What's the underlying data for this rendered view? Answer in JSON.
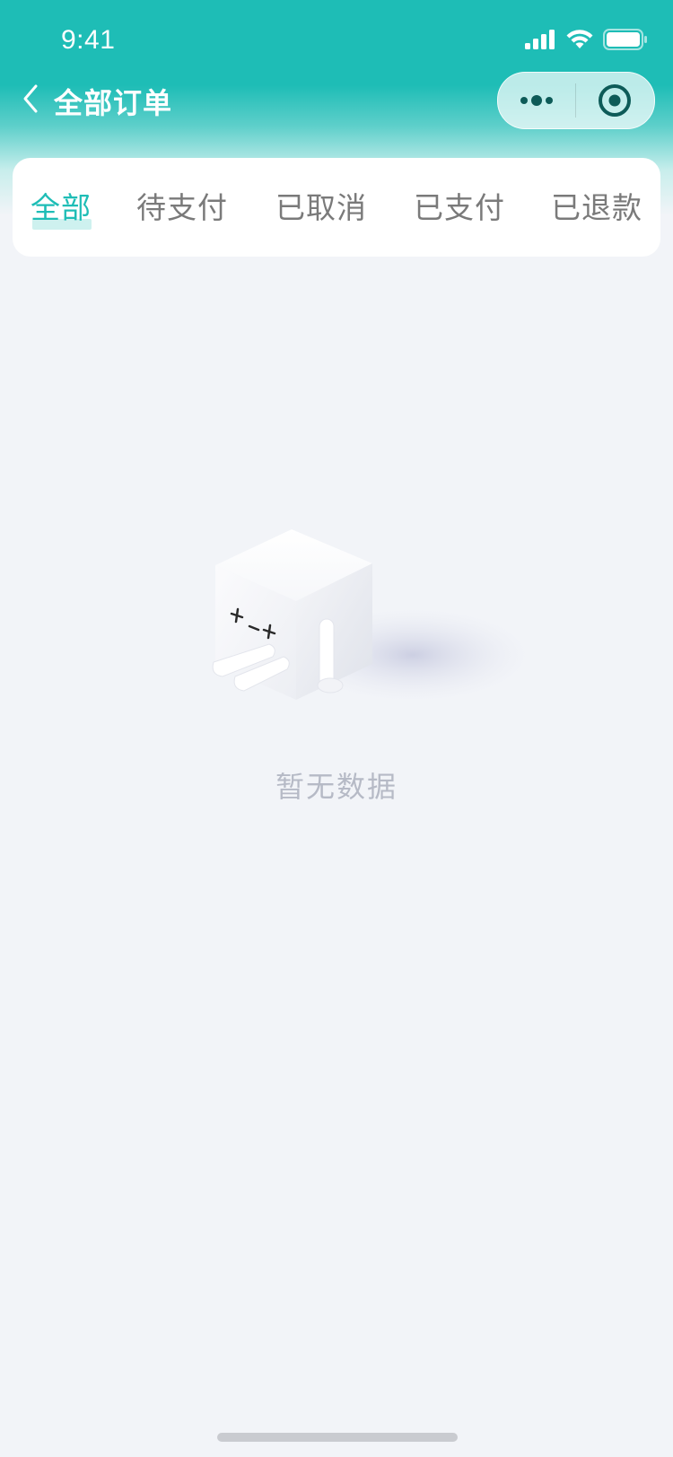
{
  "status_bar": {
    "time": "9:41"
  },
  "nav": {
    "title": "全部订单",
    "back_icon": "chevron-left-icon",
    "capsule": {
      "more_icon": "more-dots-icon",
      "close_icon": "target-circle-icon"
    }
  },
  "tabs": [
    {
      "label": "全部",
      "active": true
    },
    {
      "label": "待支付",
      "active": false
    },
    {
      "label": "已取消",
      "active": false
    },
    {
      "label": "已支付",
      "active": false
    },
    {
      "label": "已退款",
      "active": false
    }
  ],
  "empty_state": {
    "message": "暂无数据",
    "illustration": "cube-character-illustration"
  },
  "colors": {
    "accent": "#1ebdb6",
    "background": "#f2f4f8",
    "tab_inactive": "#7a7a7a",
    "empty_text": "#b6bac6"
  }
}
